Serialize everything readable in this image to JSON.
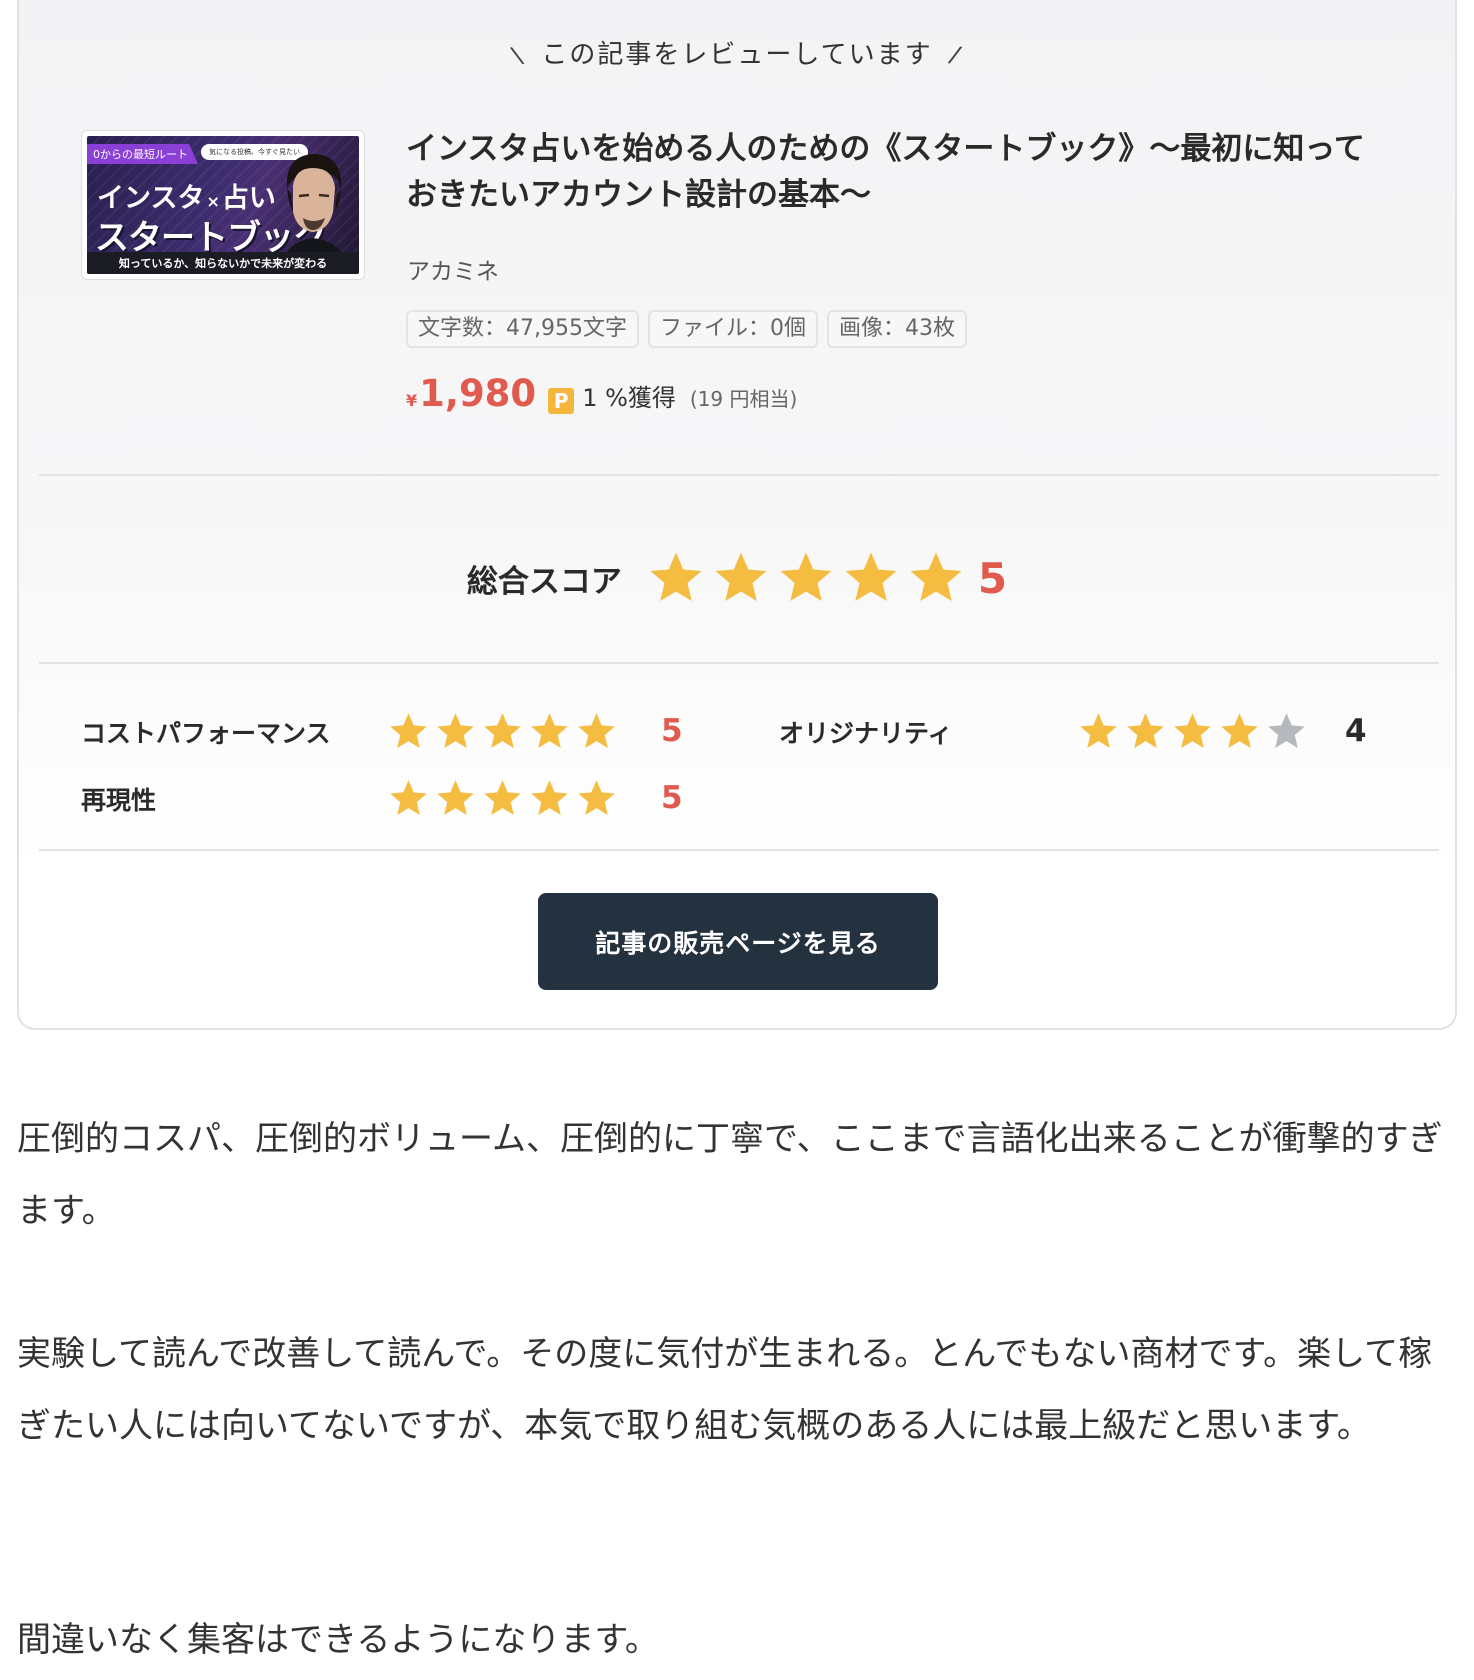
{
  "card": {
    "reviewing_label": "この記事をレビューしています",
    "thumbnail": {
      "tag": "0からの最短ルート",
      "bubble": "気になる投稿、今すぐ見たい",
      "line1_a": "インスタ",
      "line1_x": "×",
      "line1_b": "占い",
      "line2": "スタートブック",
      "footer": "知っているか、知らないかで未来が変わる"
    },
    "title": "インスタ占いを始める人のための《スタートブック》〜最初に知っておきたいアカウント設計の基本〜",
    "author": "アカミネ",
    "chips": [
      "文字数：47,955文字",
      "ファイル：0個",
      "画像：43枚"
    ],
    "price": {
      "yen": "¥",
      "amount": "1,980",
      "point_badge": "P",
      "point_rate": "1 %獲得",
      "equivalent": "(19 円相当)"
    },
    "overall": {
      "label": "総合スコア",
      "score": "5",
      "stars_filled": 5
    },
    "sub_scores": [
      {
        "label": "コストパフォーマンス",
        "score": "5",
        "stars_filled": 5
      },
      {
        "label": "オリジナリティ",
        "score": "4",
        "stars_filled": 4
      },
      {
        "label": "再現性",
        "score": "5",
        "stars_filled": 5
      }
    ],
    "cta_label": "記事の販売ページを見る"
  },
  "review_paragraphs": [
    "圧倒的コスパ、圧倒的ボリューム、圧倒的に丁寧で、ここまで言語化出来ることが衝撃的すぎます。",
    "実験して読んで改善して読んで。その度に気付が生まれる。とんでもない商材です。楽して稼ぎたい人には向いてないですが、本気で取り組む気概のある人には最上級だと思います。",
    "間違いなく集客はできるようになります。"
  ],
  "colors": {
    "star_filled": "#f4bd42",
    "star_empty": "#b5b8bd",
    "score_accent": "#e05a4e",
    "cta_bg": "#24313f",
    "price": "#e05a4e"
  }
}
